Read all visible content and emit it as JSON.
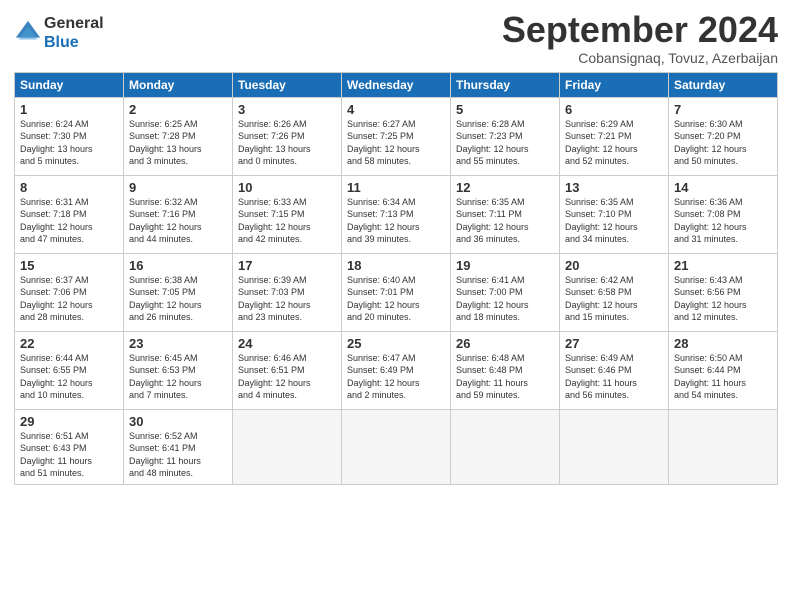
{
  "header": {
    "logo_line1": "General",
    "logo_line2": "Blue",
    "month_year": "September 2024",
    "location": "Cobansignaq, Tovuz, Azerbaijan"
  },
  "weekdays": [
    "Sunday",
    "Monday",
    "Tuesday",
    "Wednesday",
    "Thursday",
    "Friday",
    "Saturday"
  ],
  "weeks": [
    [
      {
        "day": "1",
        "info": "Sunrise: 6:24 AM\nSunset: 7:30 PM\nDaylight: 13 hours\nand 5 minutes."
      },
      {
        "day": "2",
        "info": "Sunrise: 6:25 AM\nSunset: 7:28 PM\nDaylight: 13 hours\nand 3 minutes."
      },
      {
        "day": "3",
        "info": "Sunrise: 6:26 AM\nSunset: 7:26 PM\nDaylight: 13 hours\nand 0 minutes."
      },
      {
        "day": "4",
        "info": "Sunrise: 6:27 AM\nSunset: 7:25 PM\nDaylight: 12 hours\nand 58 minutes."
      },
      {
        "day": "5",
        "info": "Sunrise: 6:28 AM\nSunset: 7:23 PM\nDaylight: 12 hours\nand 55 minutes."
      },
      {
        "day": "6",
        "info": "Sunrise: 6:29 AM\nSunset: 7:21 PM\nDaylight: 12 hours\nand 52 minutes."
      },
      {
        "day": "7",
        "info": "Sunrise: 6:30 AM\nSunset: 7:20 PM\nDaylight: 12 hours\nand 50 minutes."
      }
    ],
    [
      {
        "day": "8",
        "info": "Sunrise: 6:31 AM\nSunset: 7:18 PM\nDaylight: 12 hours\nand 47 minutes."
      },
      {
        "day": "9",
        "info": "Sunrise: 6:32 AM\nSunset: 7:16 PM\nDaylight: 12 hours\nand 44 minutes."
      },
      {
        "day": "10",
        "info": "Sunrise: 6:33 AM\nSunset: 7:15 PM\nDaylight: 12 hours\nand 42 minutes."
      },
      {
        "day": "11",
        "info": "Sunrise: 6:34 AM\nSunset: 7:13 PM\nDaylight: 12 hours\nand 39 minutes."
      },
      {
        "day": "12",
        "info": "Sunrise: 6:35 AM\nSunset: 7:11 PM\nDaylight: 12 hours\nand 36 minutes."
      },
      {
        "day": "13",
        "info": "Sunrise: 6:35 AM\nSunset: 7:10 PM\nDaylight: 12 hours\nand 34 minutes."
      },
      {
        "day": "14",
        "info": "Sunrise: 6:36 AM\nSunset: 7:08 PM\nDaylight: 12 hours\nand 31 minutes."
      }
    ],
    [
      {
        "day": "15",
        "info": "Sunrise: 6:37 AM\nSunset: 7:06 PM\nDaylight: 12 hours\nand 28 minutes."
      },
      {
        "day": "16",
        "info": "Sunrise: 6:38 AM\nSunset: 7:05 PM\nDaylight: 12 hours\nand 26 minutes."
      },
      {
        "day": "17",
        "info": "Sunrise: 6:39 AM\nSunset: 7:03 PM\nDaylight: 12 hours\nand 23 minutes."
      },
      {
        "day": "18",
        "info": "Sunrise: 6:40 AM\nSunset: 7:01 PM\nDaylight: 12 hours\nand 20 minutes."
      },
      {
        "day": "19",
        "info": "Sunrise: 6:41 AM\nSunset: 7:00 PM\nDaylight: 12 hours\nand 18 minutes."
      },
      {
        "day": "20",
        "info": "Sunrise: 6:42 AM\nSunset: 6:58 PM\nDaylight: 12 hours\nand 15 minutes."
      },
      {
        "day": "21",
        "info": "Sunrise: 6:43 AM\nSunset: 6:56 PM\nDaylight: 12 hours\nand 12 minutes."
      }
    ],
    [
      {
        "day": "22",
        "info": "Sunrise: 6:44 AM\nSunset: 6:55 PM\nDaylight: 12 hours\nand 10 minutes."
      },
      {
        "day": "23",
        "info": "Sunrise: 6:45 AM\nSunset: 6:53 PM\nDaylight: 12 hours\nand 7 minutes."
      },
      {
        "day": "24",
        "info": "Sunrise: 6:46 AM\nSunset: 6:51 PM\nDaylight: 12 hours\nand 4 minutes."
      },
      {
        "day": "25",
        "info": "Sunrise: 6:47 AM\nSunset: 6:49 PM\nDaylight: 12 hours\nand 2 minutes."
      },
      {
        "day": "26",
        "info": "Sunrise: 6:48 AM\nSunset: 6:48 PM\nDaylight: 11 hours\nand 59 minutes."
      },
      {
        "day": "27",
        "info": "Sunrise: 6:49 AM\nSunset: 6:46 PM\nDaylight: 11 hours\nand 56 minutes."
      },
      {
        "day": "28",
        "info": "Sunrise: 6:50 AM\nSunset: 6:44 PM\nDaylight: 11 hours\nand 54 minutes."
      }
    ],
    [
      {
        "day": "29",
        "info": "Sunrise: 6:51 AM\nSunset: 6:43 PM\nDaylight: 11 hours\nand 51 minutes."
      },
      {
        "day": "30",
        "info": "Sunrise: 6:52 AM\nSunset: 6:41 PM\nDaylight: 11 hours\nand 48 minutes."
      },
      {
        "day": "",
        "info": ""
      },
      {
        "day": "",
        "info": ""
      },
      {
        "day": "",
        "info": ""
      },
      {
        "day": "",
        "info": ""
      },
      {
        "day": "",
        "info": ""
      }
    ]
  ]
}
